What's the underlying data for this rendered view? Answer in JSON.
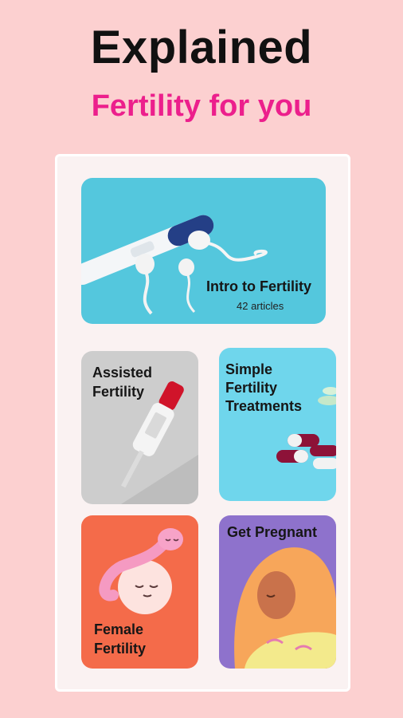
{
  "header": {
    "title": "Explained",
    "subtitle": "Fertility for you"
  },
  "cards": {
    "intro": {
      "title": "Intro to Fertility",
      "subtitle": "42 articles"
    },
    "assisted": {
      "title_line1": "Assisted",
      "title_line2": "Fertility"
    },
    "simple": {
      "title_line1": "Simple",
      "title_line2": "Fertility",
      "title_line3": "Treatments"
    },
    "female": {
      "title_line1": "Female",
      "title_line2": "Fertility"
    },
    "pregnant": {
      "title": "Get Pregnant"
    }
  },
  "colors": {
    "background": "#fcd0d0",
    "accent": "#ec1f8c",
    "panel": "#faf2f2"
  }
}
